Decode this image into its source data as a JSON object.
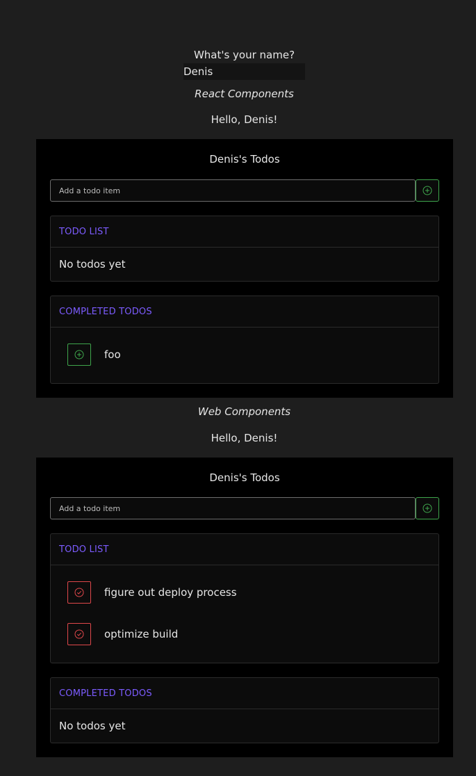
{
  "name_prompt": "What's your name?",
  "name_value": "Denis",
  "sections": [
    {
      "title": "React Components",
      "hello": "Hello, Denis!",
      "panel_title": "Denis's Todos",
      "add_placeholder": "Add a todo item",
      "todo_list": {
        "header": "TODO LIST",
        "empty_text": "No todos yet",
        "items": []
      },
      "completed": {
        "header": "COMPLETED TODOS",
        "items": [
          "foo"
        ]
      }
    },
    {
      "title": "Web Components",
      "hello": "Hello, Denis!",
      "panel_title": "Denis's Todos",
      "add_placeholder": "Add a todo item",
      "todo_list": {
        "header": "TODO LIST",
        "items": [
          "figure out deploy process",
          "optimize build"
        ]
      },
      "completed": {
        "header": "COMPLETED TODOS",
        "empty_text": "No todos yet",
        "items": []
      }
    }
  ],
  "colors": {
    "accent_purple": "#7c5cff",
    "add_green": "#3fa64c",
    "done_red": "#e0484b"
  },
  "icons": {
    "add": "plus-circle-icon",
    "complete": "check-circle-icon"
  }
}
